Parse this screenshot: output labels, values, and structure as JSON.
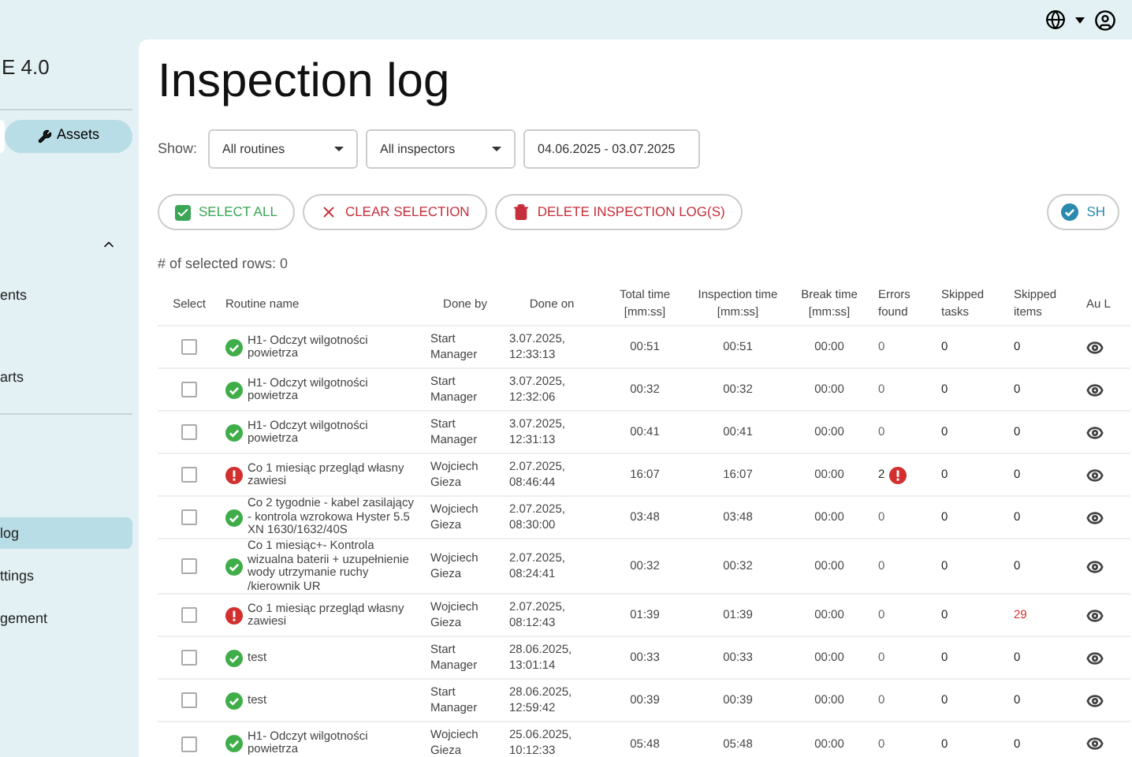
{
  "sidebar": {
    "app_title": "E 4.0",
    "tabs": [
      {
        "selected": true
      },
      {
        "label": "Assets",
        "selected": false
      }
    ],
    "items": [
      {
        "label": "ents",
        "selected": false
      },
      {
        "label": "arts",
        "selected": false
      },
      {
        "label": "log",
        "selected": true
      },
      {
        "label": "ttings",
        "selected": false
      },
      {
        "label": "gement",
        "selected": false
      }
    ]
  },
  "page": {
    "title": "Inspection log",
    "show_label": "Show:",
    "filters": [
      {
        "kind": "select",
        "value": "All routines"
      },
      {
        "kind": "select",
        "value": "All inspectors"
      },
      {
        "kind": "date",
        "value": "04.06.2025 - 03.07.2025"
      }
    ],
    "actions": [
      {
        "kind": "select_all",
        "label": "SELECT ALL"
      },
      {
        "kind": "clear",
        "label": "CLEAR SELECTION"
      },
      {
        "kind": "delete",
        "label": "DELETE INSPECTION LOG(S)"
      }
    ],
    "show_button": "SH",
    "selected_count": "# of selected rows: 0"
  },
  "table": {
    "columns": [
      "Select",
      "Routine name",
      "Done by",
      "Done on",
      "Total time [mm:ss]",
      "Inspection time [mm:ss]",
      "Break time [mm:ss]",
      "Errors found",
      "Skipped tasks",
      "Skipped items",
      "Au L"
    ],
    "rows": [
      {
        "checked": false,
        "failed": false,
        "routine": "H1- Odczyt wilgotności powietrza",
        "done_by": "Start Manager",
        "done_on": "3.07.2025, 12:33:13",
        "total": "00:51",
        "inspection": "00:51",
        "break": "00:00",
        "errors": "0",
        "errors_flagged": false,
        "skipped_tasks": "0",
        "skipped_items": "0",
        "skipped_flagged": false
      },
      {
        "checked": false,
        "failed": false,
        "routine": "H1- Odczyt wilgotności powietrza",
        "done_by": "Start Manager",
        "done_on": "3.07.2025, 12:32:06",
        "total": "00:32",
        "inspection": "00:32",
        "break": "00:00",
        "errors": "0",
        "errors_flagged": false,
        "skipped_tasks": "0",
        "skipped_items": "0",
        "skipped_flagged": false
      },
      {
        "checked": false,
        "failed": false,
        "routine": "H1- Odczyt wilgotności powietrza",
        "done_by": "Start Manager",
        "done_on": "3.07.2025, 12:31:13",
        "total": "00:41",
        "inspection": "00:41",
        "break": "00:00",
        "errors": "0",
        "errors_flagged": false,
        "skipped_tasks": "0",
        "skipped_items": "0",
        "skipped_flagged": false
      },
      {
        "checked": false,
        "failed": true,
        "routine": "Co 1 miesiąc przegląd własny zawiesi",
        "done_by": "Wojciech Gieza",
        "done_on": "2.07.2025, 08:46:44",
        "total": "16:07",
        "inspection": "16:07",
        "break": "00:00",
        "errors": "2",
        "errors_flagged": true,
        "skipped_tasks": "0",
        "skipped_items": "0",
        "skipped_flagged": false
      },
      {
        "checked": false,
        "failed": false,
        "routine": "Co 2 tygodnie - kabel zasilający - kontrola wzrokowa Hyster 5.5 XN 1630/1632/40S",
        "done_by": "Wojciech Gieza",
        "done_on": "2.07.2025, 08:30:00",
        "total": "03:48",
        "inspection": "03:48",
        "break": "00:00",
        "errors": "0",
        "errors_flagged": false,
        "skipped_tasks": "0",
        "skipped_items": "0",
        "skipped_flagged": false
      },
      {
        "checked": false,
        "failed": false,
        "routine": "Co 1 miesiąc+- Kontrola wizualna baterii + uzupełnienie wody utrzymanie ruchy /kierownik UR",
        "done_by": "Wojciech Gieza",
        "done_on": "2.07.2025, 08:24:41",
        "total": "00:32",
        "inspection": "00:32",
        "break": "00:00",
        "errors": "0",
        "errors_flagged": false,
        "skipped_tasks": "0",
        "skipped_items": "0",
        "skipped_flagged": false
      },
      {
        "checked": false,
        "failed": true,
        "routine": "Co 1 miesiąc przegląd własny zawiesi",
        "done_by": "Wojciech Gieza",
        "done_on": "2.07.2025, 08:12:43",
        "total": "01:39",
        "inspection": "01:39",
        "break": "00:00",
        "errors": "0",
        "errors_flagged": false,
        "skipped_tasks": "0",
        "skipped_items": "29",
        "skipped_flagged": true
      },
      {
        "checked": false,
        "failed": false,
        "routine": "test",
        "done_by": "Start Manager",
        "done_on": "28.06.2025, 13:01:14",
        "total": "00:33",
        "inspection": "00:33",
        "break": "00:00",
        "errors": "0",
        "errors_flagged": false,
        "skipped_tasks": "0",
        "skipped_items": "0",
        "skipped_flagged": false
      },
      {
        "checked": false,
        "failed": false,
        "routine": "test",
        "done_by": "Start Manager",
        "done_on": "28.06.2025, 12:59:42",
        "total": "00:39",
        "inspection": "00:39",
        "break": "00:00",
        "errors": "0",
        "errors_flagged": false,
        "skipped_tasks": "0",
        "skipped_items": "0",
        "skipped_flagged": false
      },
      {
        "checked": false,
        "failed": false,
        "routine": "H1- Odczyt wilgotności powietrza",
        "done_by": "Wojciech Gieza",
        "done_on": "25.06.2025, 10:12:33",
        "total": "05:48",
        "inspection": "05:48",
        "break": "00:00",
        "errors": "0",
        "errors_flagged": false,
        "skipped_tasks": "0",
        "skipped_items": "0",
        "skipped_flagged": false
      }
    ]
  }
}
